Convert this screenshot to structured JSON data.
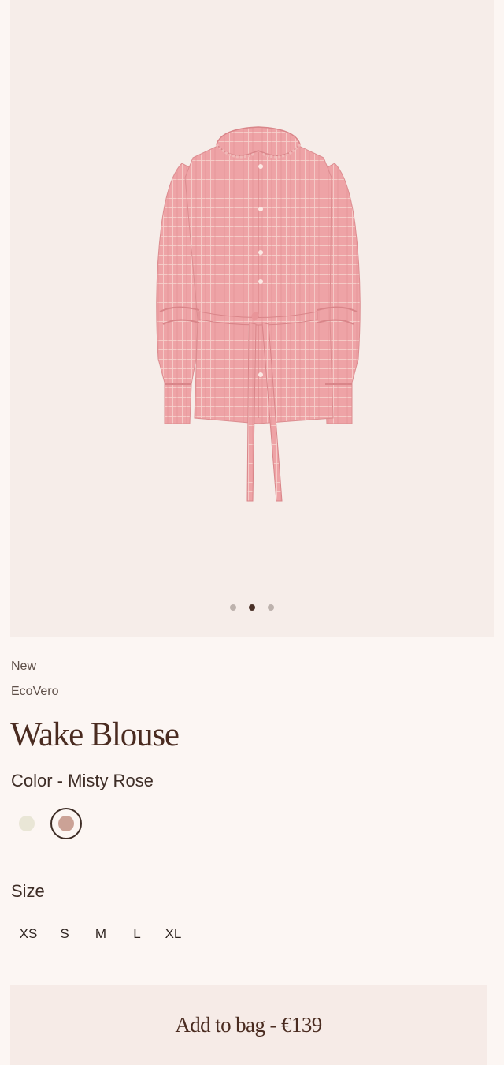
{
  "product": {
    "image_alt": "Pink checked blouse with ruffled collar and tie belt",
    "gallery": {
      "slides": 3,
      "active_slide": 2
    },
    "tags": [
      "New",
      "EcoVero"
    ],
    "title": "Wake Blouse",
    "color_text": "Color - Misty Rose",
    "swatches": [
      {
        "name": "Ivory",
        "hex": "#e9e6d6",
        "selected": false
      },
      {
        "name": "Misty Rose",
        "hex": "#cba296",
        "selected": true
      }
    ],
    "size_label": "Size",
    "sizes": [
      "XS",
      "S",
      "M",
      "L",
      "XL"
    ],
    "add_to_bag": "Add to bag - €139"
  },
  "colors": {
    "background": "#fcf6f3",
    "gallery_bg": "#f6ede9",
    "button_bg": "#f6ebe7",
    "text_brown": "#4a2b20"
  }
}
